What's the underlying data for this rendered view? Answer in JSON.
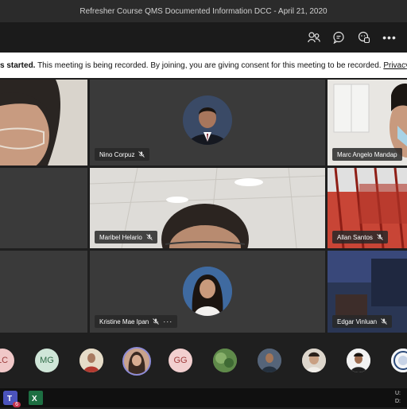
{
  "window": {
    "title": "Refresher Course QMS Documented Information DCC - April 21, 2020"
  },
  "toolbar": {
    "participants_icon": "participants-icon",
    "chat_icon": "chat-icon",
    "reactions_icon": "reactions-icon",
    "more_icon": "more-options-icon"
  },
  "banner": {
    "lead": "s started.",
    "message": " This meeting is being recorded. By joining, you are giving consent for this meeting to be recorded. ",
    "link": "Privacy policy"
  },
  "participants": [
    {
      "name": "Nino Corpuz",
      "muted": true
    },
    {
      "name": "Marc Angelo Mandap",
      "muted": true
    },
    {
      "name": "Maribel Helario",
      "muted": true
    },
    {
      "name": "Allan Santos",
      "muted": true
    },
    {
      "name": "Kristine Mae Ipan",
      "muted": true,
      "more": "···"
    },
    {
      "name": "Edgar Vinluan",
      "muted": true
    }
  ],
  "people_row": [
    {
      "initials": "LC",
      "color": "#f0c8c8",
      "text_color": "#9b3b3b"
    },
    {
      "initials": "MG",
      "color": "#cfe6d8",
      "text_color": "#2f6b47"
    },
    {
      "initials": "",
      "color": "#c9b59a"
    },
    {
      "initials": "",
      "color": "#b58b76",
      "highlight": true
    },
    {
      "initials": "GG",
      "color": "#f2cfcf",
      "text_color": "#a03d3d"
    },
    {
      "initials": "",
      "color": "#6f8f5a"
    },
    {
      "initials": "",
      "color": "#4b5a6e"
    },
    {
      "initials": "",
      "color": "#d8d2c8"
    },
    {
      "initials": "",
      "color": "#e8e8e8"
    },
    {
      "initials": "",
      "color": "#e9ecef"
    }
  ],
  "taskbar": {
    "teams_badge": "6",
    "clock_line1": "U:",
    "clock_line2": "D:"
  }
}
